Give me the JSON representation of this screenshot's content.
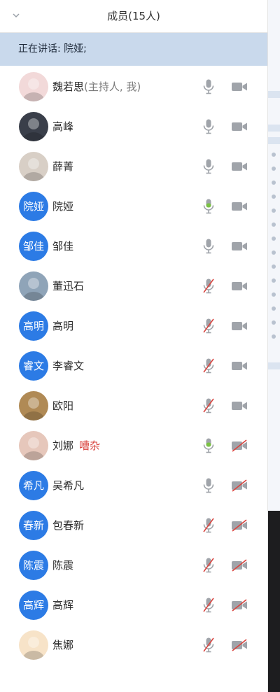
{
  "header": {
    "title": "成员(15人)"
  },
  "speaking": {
    "text": "正在讲话: 院娅;"
  },
  "members": [
    {
      "name": "魏若思",
      "host": "(主持人, 我)",
      "tag": "",
      "avatar_type": "photo",
      "avatar_label": "",
      "mic": "on",
      "cam": "on",
      "photo_color": "#f2d9d9"
    },
    {
      "name": "高峰",
      "host": "",
      "tag": "",
      "avatar_type": "photo",
      "avatar_label": "",
      "mic": "on",
      "cam": "on",
      "photo_color": "#3a3f4a"
    },
    {
      "name": "薛菁",
      "host": "",
      "tag": "",
      "avatar_type": "photo",
      "avatar_label": "",
      "mic": "on",
      "cam": "on",
      "photo_color": "#d8cfc6"
    },
    {
      "name": "院娅",
      "host": "",
      "tag": "",
      "avatar_type": "text",
      "avatar_label": "院娅",
      "mic": "speaking",
      "cam": "on"
    },
    {
      "name": "邹佳",
      "host": "",
      "tag": "",
      "avatar_type": "text",
      "avatar_label": "邹佳",
      "mic": "on",
      "cam": "on"
    },
    {
      "name": "董迅石",
      "host": "",
      "tag": "",
      "avatar_type": "photo",
      "avatar_label": "",
      "mic": "muted",
      "cam": "on",
      "photo_color": "#8fa4b8"
    },
    {
      "name": "高明",
      "host": "",
      "tag": "",
      "avatar_type": "text",
      "avatar_label": "高明",
      "mic": "muted",
      "cam": "on"
    },
    {
      "name": "李睿文",
      "host": "",
      "tag": "",
      "avatar_type": "text",
      "avatar_label": "睿文",
      "mic": "muted",
      "cam": "on"
    },
    {
      "name": "欧阳",
      "host": "",
      "tag": "",
      "avatar_type": "photo",
      "avatar_label": "",
      "mic": "muted",
      "cam": "on",
      "photo_color": "#b08a55"
    },
    {
      "name": "刘娜",
      "host": "",
      "tag": "嘈杂",
      "avatar_type": "photo",
      "avatar_label": "",
      "mic": "speaking",
      "cam": "off",
      "photo_color": "#e6c7bb"
    },
    {
      "name": "吴希凡",
      "host": "",
      "tag": "",
      "avatar_type": "text",
      "avatar_label": "希凡",
      "mic": "on",
      "cam": "off"
    },
    {
      "name": "包春新",
      "host": "",
      "tag": "",
      "avatar_type": "text",
      "avatar_label": "春新",
      "mic": "muted",
      "cam": "off"
    },
    {
      "name": "陈震",
      "host": "",
      "tag": "",
      "avatar_type": "text",
      "avatar_label": "陈震",
      "mic": "muted",
      "cam": "off"
    },
    {
      "name": "高辉",
      "host": "",
      "tag": "",
      "avatar_type": "text",
      "avatar_label": "高辉",
      "mic": "muted",
      "cam": "off"
    },
    {
      "name": "焦娜",
      "host": "",
      "tag": "",
      "avatar_type": "photo",
      "avatar_label": "",
      "mic": "muted",
      "cam": "off",
      "photo_color": "#f7e3c8"
    }
  ],
  "colors": {
    "avatar_blue": "#2c7be5",
    "speaking_band": "#c9d9ec",
    "mic_active": "#7ac143",
    "muted_red": "#d9443f",
    "icon_gray": "#a0a4aa"
  }
}
